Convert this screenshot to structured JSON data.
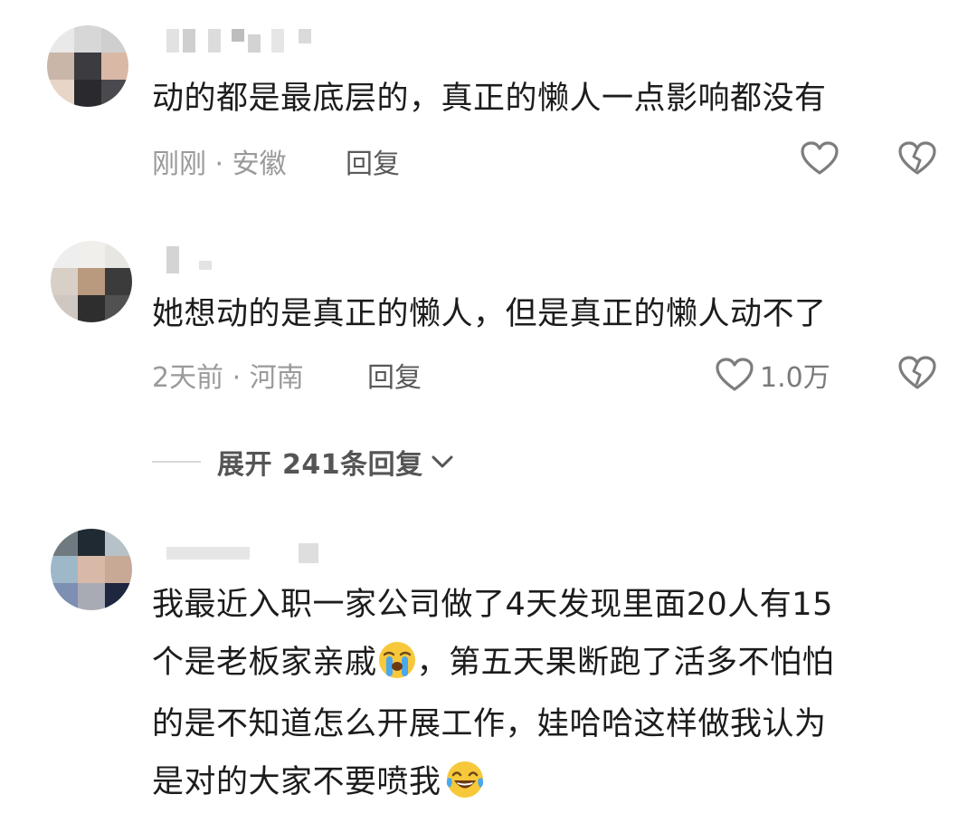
{
  "comments": [
    {
      "text": "动的都是最底层的，真正的懒人一点影响都没有",
      "time": "刚刚",
      "location": "安徽",
      "reply_label": "回复",
      "like_count": ""
    },
    {
      "text": "她想动的是真正的懒人，但是真正的懒人动不了",
      "time": "2天前",
      "location": "河南",
      "reply_label": "回复",
      "like_count": "1.0万"
    },
    {
      "lines": [
        "我最近入职一家公司做了4天发现里面20人有15",
        "个是老板家亲戚",
        "，第五天果断跑了活多不怕怕",
        "的是不知道怎么开展工作，娃哈哈这样做我认为",
        "是对的大家不要喷我"
      ]
    }
  ],
  "meta_separator": " · ",
  "expand_replies_label": "展开 241条回复",
  "icons": {
    "like": "heart-outline-icon",
    "dislike": "broken-heart-icon",
    "expand": "chevron-down-icon",
    "emoji_1": "loudly-crying-face",
    "emoji_2": "face-with-tears-of-joy"
  },
  "colors": {
    "text": "#1c1c1c",
    "meta": "#9a9a9a",
    "reply": "#5a5a5a",
    "icon": "#7d7d7d"
  }
}
